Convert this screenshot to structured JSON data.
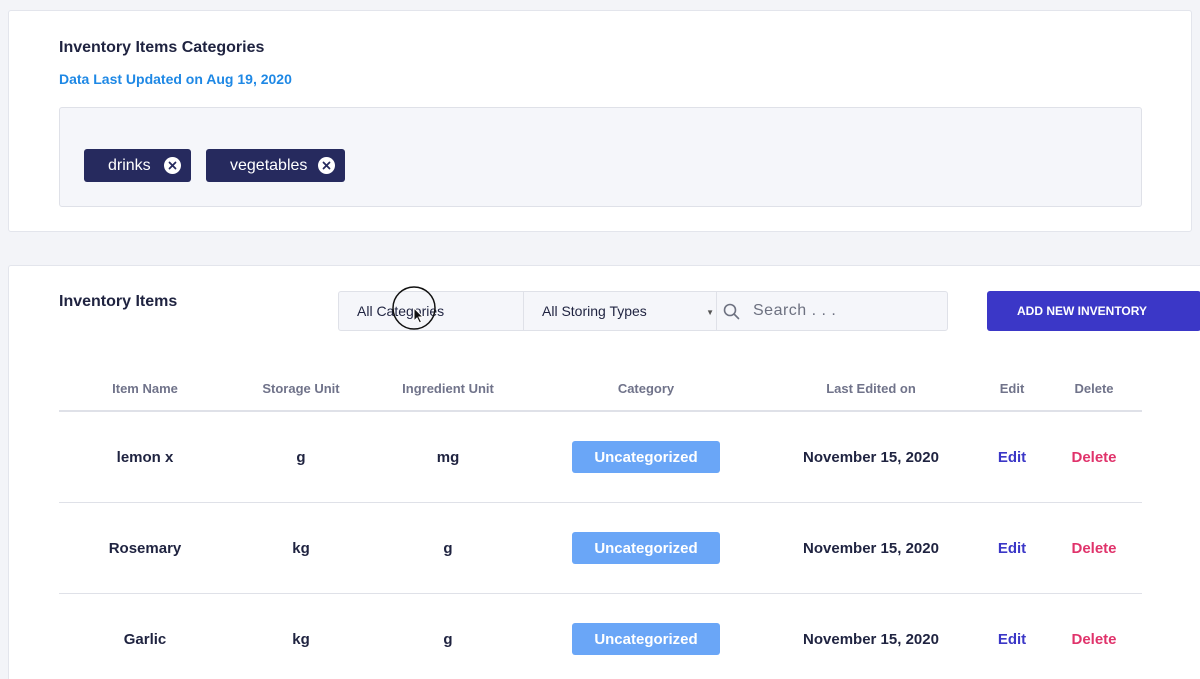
{
  "categories_card": {
    "title": "Inventory Items Categories",
    "updated": "Data Last Updated on Aug 19, 2020",
    "tags": [
      {
        "label": "drinks"
      },
      {
        "label": "vegetables"
      }
    ]
  },
  "items_card": {
    "title": "Inventory Items",
    "filters": {
      "category": "All Categories",
      "storing_type": "All Storing Types",
      "search_placeholder": "Search . . ."
    },
    "add_button": "ADD NEW INVENTORY",
    "columns": [
      "Item Name",
      "Storage Unit",
      "Ingredient Unit",
      "Category",
      "Last Edited on",
      "Edit",
      "Delete"
    ],
    "rows": [
      {
        "name": "lemon x",
        "storage": "g",
        "ingredient": "mg",
        "category": "Uncategorized",
        "edited": "November 15, 2020",
        "edit": "Edit",
        "delete": "Delete"
      },
      {
        "name": "Rosemary",
        "storage": "kg",
        "ingredient": "g",
        "category": "Uncategorized",
        "edited": "November 15, 2020",
        "edit": "Edit",
        "delete": "Delete"
      },
      {
        "name": "Garlic",
        "storage": "kg",
        "ingredient": "g",
        "category": "Uncategorized",
        "edited": "November 15, 2020",
        "edit": "Edit",
        "delete": "Delete"
      }
    ]
  },
  "colors": {
    "background": "#f3f4f8",
    "tag": "#262a5e",
    "accent": "#3b37c7",
    "link_blue": "#1e88e5",
    "badge": "#6aa6f7",
    "delete": "#e0336b"
  },
  "icons": {
    "tag_remove": "close-circle-icon",
    "search": "search-icon",
    "select": "chevron-down-icon",
    "cursor": "mouse-pointer-icon"
  }
}
